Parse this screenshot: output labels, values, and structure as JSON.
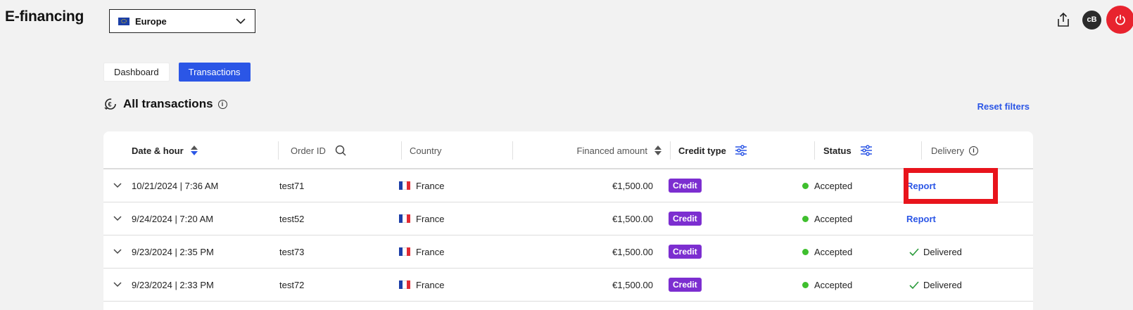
{
  "app": {
    "title": "E-financing"
  },
  "region": {
    "selected": "Europe"
  },
  "header": {
    "avatar_initials": "cB",
    "icons": [
      "share-icon",
      "power-icon"
    ]
  },
  "tabs": [
    {
      "label": "Dashboard",
      "active": false
    },
    {
      "label": "Transactions",
      "active": true
    }
  ],
  "section": {
    "title": "All transactions",
    "info": "i",
    "reset_label": "Reset filters"
  },
  "table": {
    "columns": {
      "date": "Date & hour",
      "order": "Order ID",
      "country": "Country",
      "amount": "Financed amount",
      "credit": "Credit type",
      "status": "Status",
      "delivery": "Delivery"
    },
    "rows": [
      {
        "date": "10/21/2024 | 7:36 AM",
        "order": "test71",
        "country": "France",
        "amount": "€1,500.00",
        "credit": "Credit",
        "status": "Accepted",
        "delivery": "Report",
        "delivery_type": "link"
      },
      {
        "date": "9/24/2024 | 7:20 AM",
        "order": "test52",
        "country": "France",
        "amount": "€1,500.00",
        "credit": "Credit",
        "status": "Accepted",
        "delivery": "Report",
        "delivery_type": "link"
      },
      {
        "date": "9/23/2024 | 2:35 PM",
        "order": "test73",
        "country": "France",
        "amount": "€1,500.00",
        "credit": "Credit",
        "status": "Accepted",
        "delivery": "Delivered",
        "delivery_type": "delivered"
      },
      {
        "date": "9/23/2024 | 2:33 PM",
        "order": "test72",
        "country": "France",
        "amount": "€1,500.00",
        "credit": "Credit",
        "status": "Accepted",
        "delivery": "Delivered",
        "delivery_type": "delivered"
      }
    ]
  },
  "colors": {
    "accent": "#2b56e6",
    "credit_badge": "#7c2ed0",
    "status_ok": "#3fbf2e",
    "power": "#e8232e",
    "highlight": "#e8141c"
  }
}
